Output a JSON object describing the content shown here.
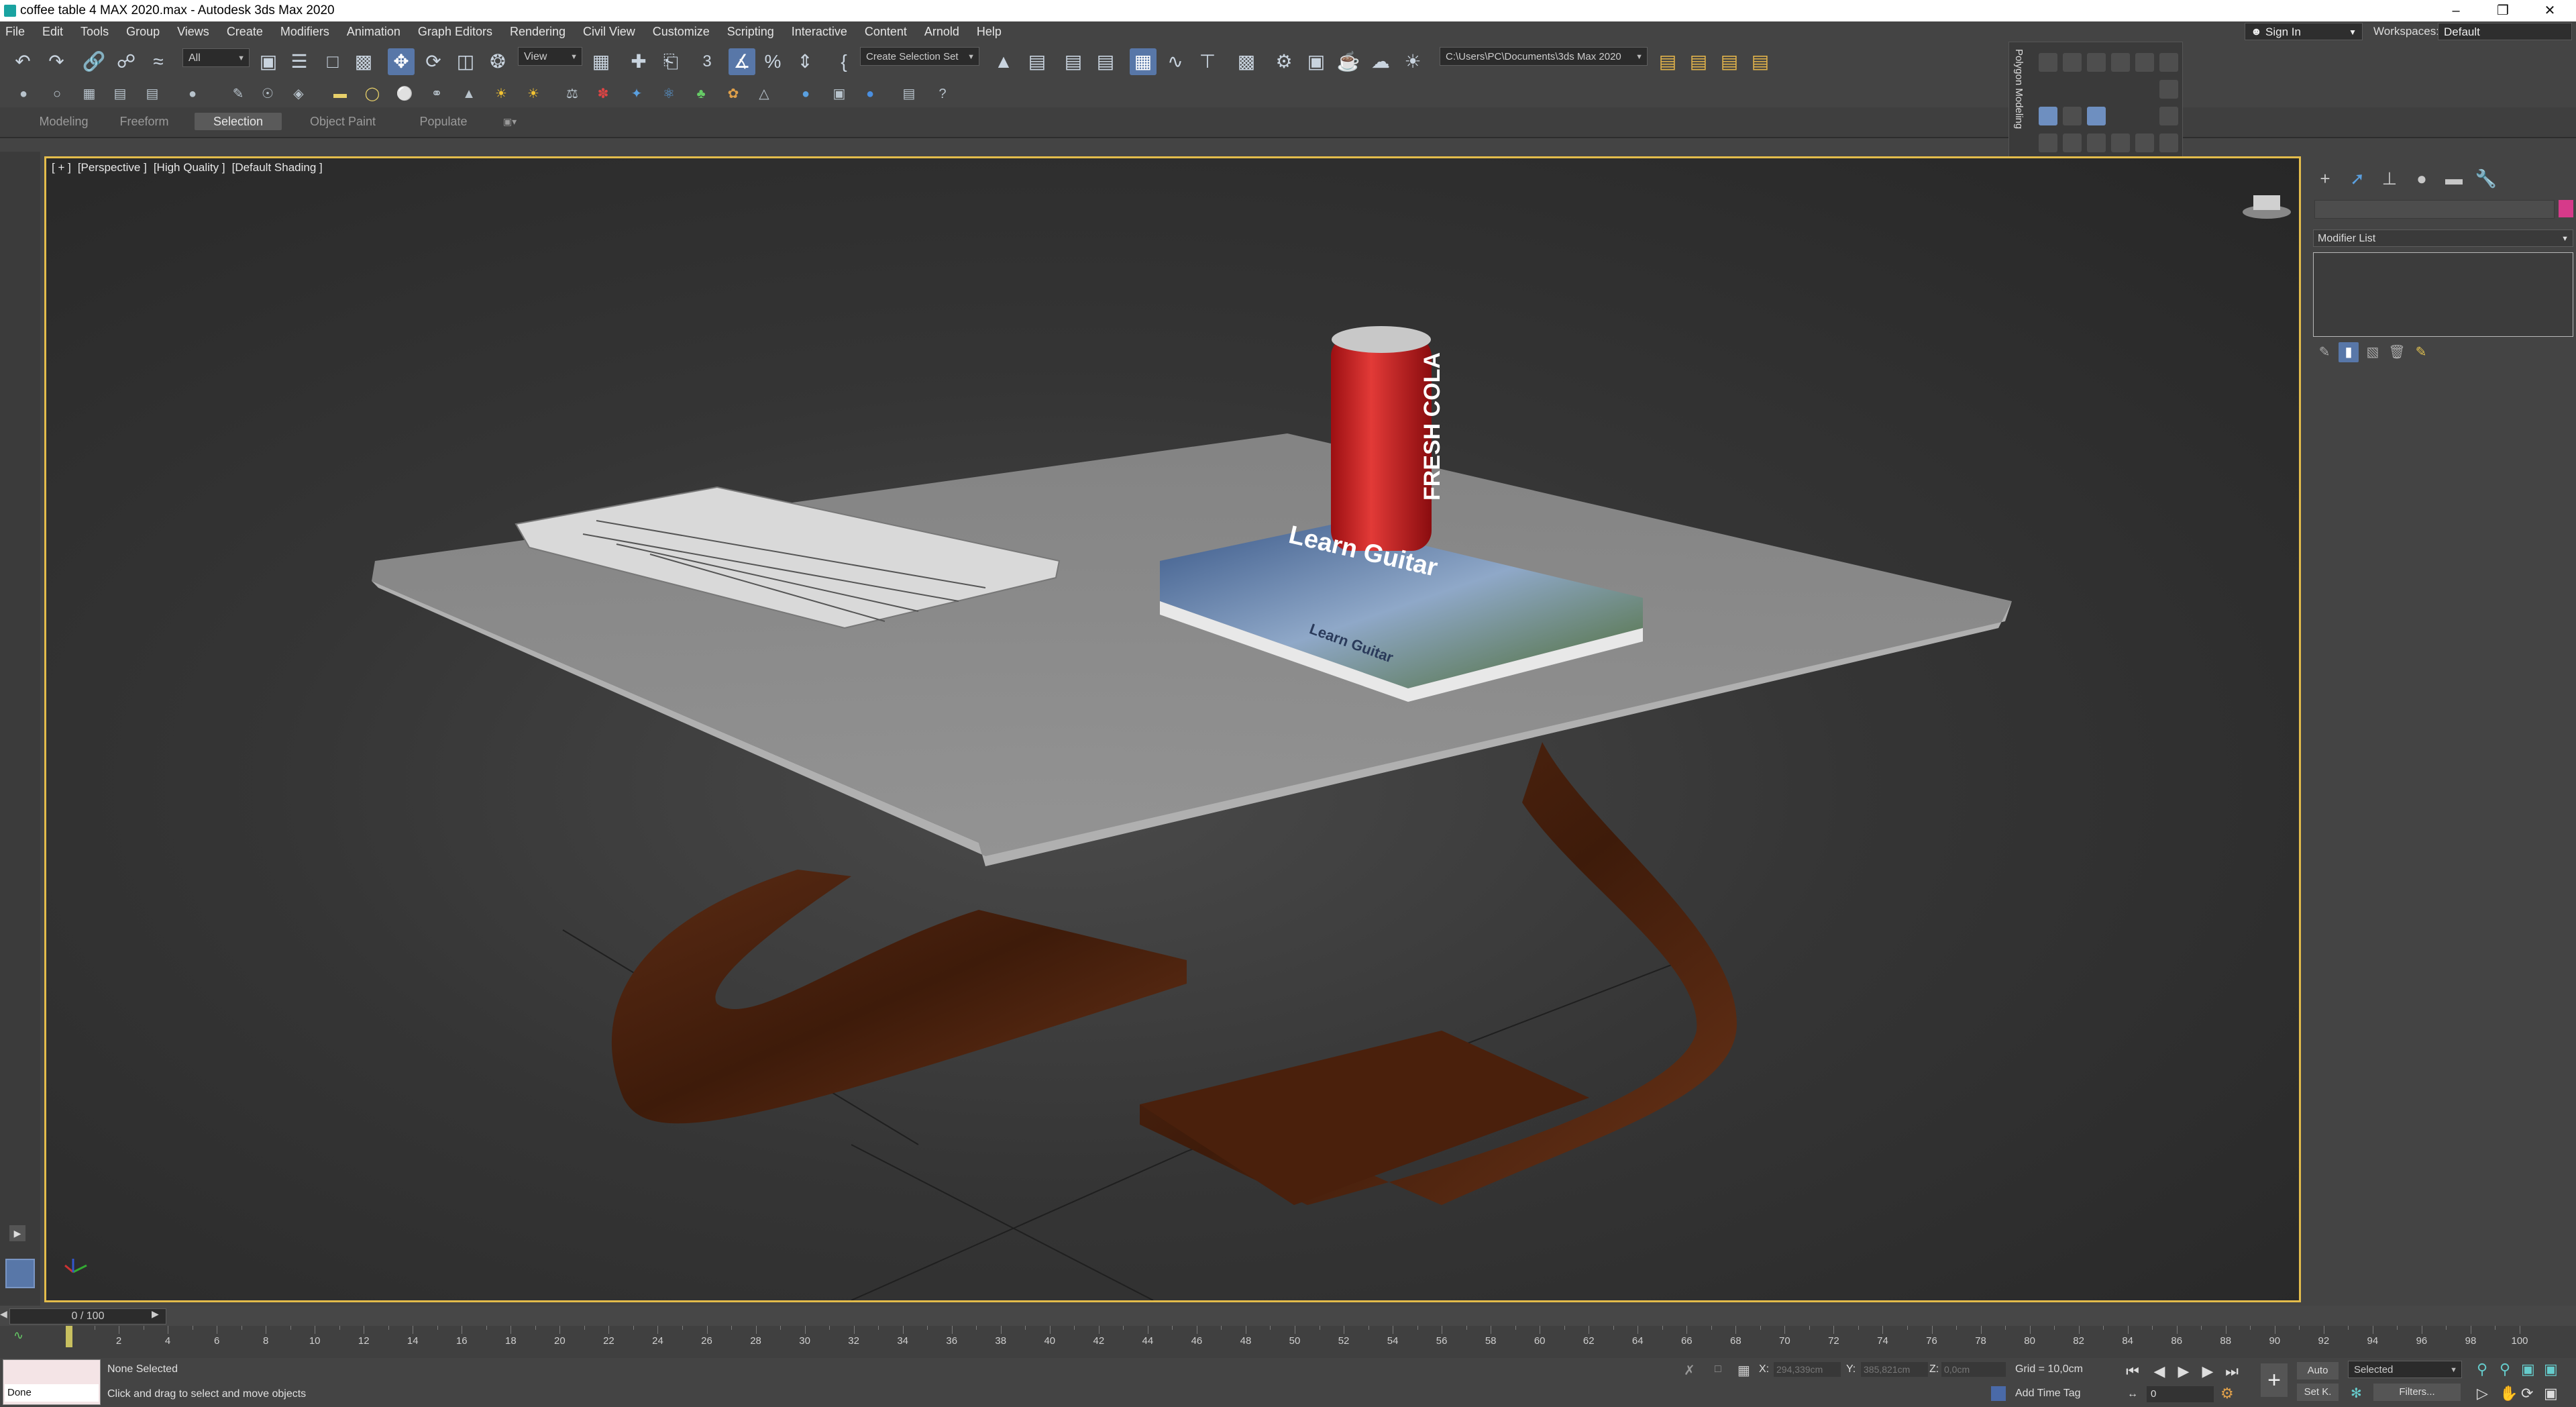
{
  "window": {
    "title": "coffee table 4 MAX 2020.max - Autodesk 3ds Max 2020",
    "minimize": "–",
    "restore": "❐",
    "close": "✕"
  },
  "menu": [
    "File",
    "Edit",
    "Tools",
    "Group",
    "Views",
    "Create",
    "Modifiers",
    "Animation",
    "Graph Editors",
    "Rendering",
    "Civil View",
    "Customize",
    "Scripting",
    "Interactive",
    "Content",
    "Arnold",
    "Help"
  ],
  "account": {
    "sign_in": "Sign In",
    "workspaces_label": "Workspaces:",
    "workspace": "Default"
  },
  "toolbar": {
    "selection_filter": "All",
    "reference_coord": "View",
    "snap_label": "3",
    "selection_set": "Create Selection Set",
    "project_path": "C:\\Users\\PC\\Documents\\3ds Max 2020"
  },
  "ribbon": {
    "tabs": [
      "Modeling",
      "Freeform",
      "Selection",
      "Object Paint",
      "Populate"
    ],
    "active": "Selection"
  },
  "polygon_panel": {
    "title": "Polygon Modeling"
  },
  "viewport": {
    "label": [
      "[ + ]",
      "[Perspective ]",
      "[High Quality ]",
      "[Default Shading ]"
    ],
    "scene": {
      "can_text": "FRESH COLA",
      "book_title": "Learn Guitar",
      "book_spine": "Learn Guitar"
    }
  },
  "command_panel": {
    "modifier_list": "Modifier List",
    "swatch_color": "#d63a8a"
  },
  "timeline": {
    "slider": "0 / 100",
    "ticks": [
      0,
      2,
      4,
      6,
      8,
      10,
      12,
      14,
      16,
      18,
      20,
      22,
      24,
      26,
      28,
      30,
      32,
      34,
      36,
      38,
      40,
      42,
      44,
      46,
      48,
      50,
      52,
      54,
      56,
      58,
      60,
      62,
      64,
      66,
      68,
      70,
      72,
      74,
      76,
      78,
      80,
      82,
      84,
      86,
      88,
      90,
      92,
      94,
      96,
      98,
      100
    ]
  },
  "status": {
    "maxscript": "Done",
    "selection": "None Selected",
    "prompt": "Click and drag to select and move objects",
    "x_label": "X:",
    "x_value": "294,339cm",
    "y_label": "Y:",
    "y_value": "385,821cm",
    "z_label": "Z:",
    "z_value": "0,0cm",
    "grid": "Grid = 10,0cm",
    "add_time_tag": "Add Time Tag",
    "auto_key": "Auto",
    "set_key": "Set K.",
    "key_filter": "Selected",
    "filters": "Filters...",
    "frame": "0"
  }
}
